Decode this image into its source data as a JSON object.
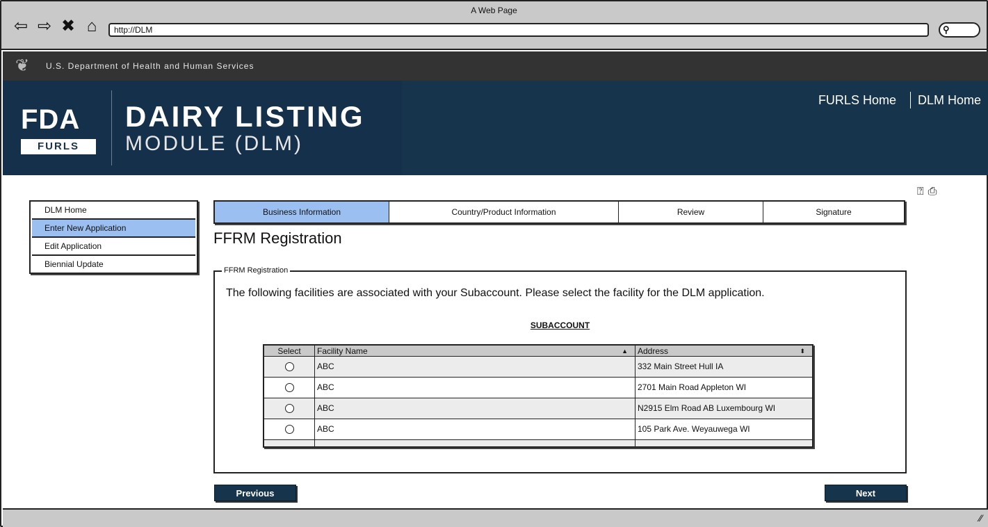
{
  "browser": {
    "window_title": "A Web Page",
    "url": "http://DLM",
    "icons": [
      "back-arrow-icon",
      "forward-arrow-icon",
      "stop-icon",
      "home-icon",
      "search-icon"
    ]
  },
  "hhs_bar": {
    "text": "U.S. Department of Health and Human Services"
  },
  "header": {
    "logo_mark": "FDA",
    "logo_sub": "FURLS",
    "title": "DAIRY LISTING",
    "subtitle": "MODULE (DLM)",
    "links": [
      "FURLS Home",
      "DLM Home"
    ]
  },
  "sidebar": {
    "items": [
      {
        "label": "DLM Home",
        "active": false
      },
      {
        "label": "Enter New Application",
        "active": true
      },
      {
        "label": "Edit Application",
        "active": false
      },
      {
        "label": "Biennial Update",
        "active": false
      }
    ]
  },
  "tabs": [
    {
      "label": "Business Information",
      "active": true
    },
    {
      "label": "Country/Product Information",
      "active": false
    },
    {
      "label": "Review",
      "active": false
    },
    {
      "label": "Signature",
      "active": false
    }
  ],
  "main": {
    "title": "FFRM Registration",
    "fieldset_legend": "FFRM Registration",
    "instructions": "The following facilities are associated with your Subaccount. Please select the facility for the DLM application.",
    "subaccount_label": "SUBACCOUNT"
  },
  "table": {
    "columns": [
      "Select",
      "Facility Name",
      "Address"
    ],
    "rows": [
      {
        "name": "ABC",
        "address": "332 Main Street Hull IA"
      },
      {
        "name": "ABC",
        "address": "2701 Main Road Appleton WI"
      },
      {
        "name": "ABC",
        "address": "N2915 Elm Road AB Luxembourg WI"
      },
      {
        "name": "ABC",
        "address": "105 Park Ave. Weyauwega WI"
      }
    ]
  },
  "buttons": {
    "previous": "Previous",
    "next": "Next"
  },
  "colors": {
    "header_bg": "#17344d",
    "hhs_bar_bg": "#333333",
    "active_highlight": "#9bbff0",
    "chrome_bg": "#c9c9c9"
  }
}
